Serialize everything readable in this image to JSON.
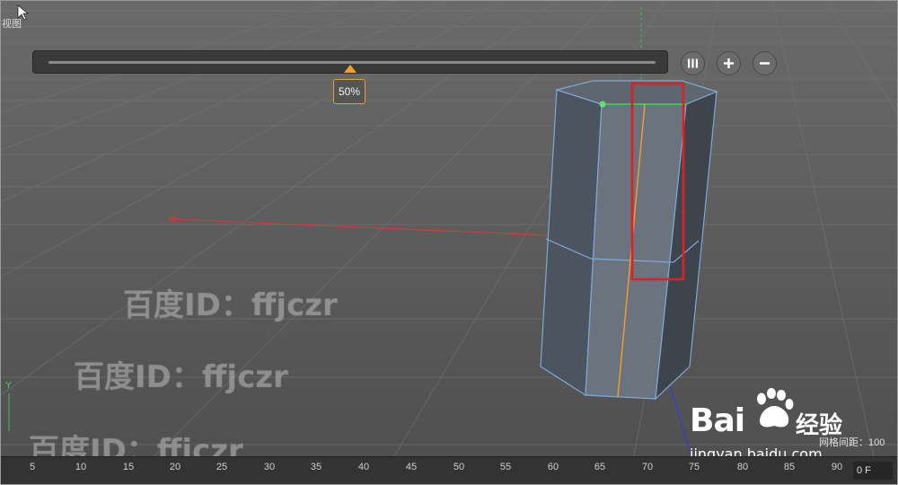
{
  "viewport": {
    "view_label": "视图",
    "slider_percent_label": "50%",
    "slider_value": 0.5,
    "grid_spacing_label": "网格间距：100"
  },
  "watermarks": [
    "百度ID：ffjczr",
    "百度ID：ffjczr",
    "百度ID：ffjczr"
  ],
  "baidu": {
    "logo_text": "Bai",
    "jingyan_text": "经验",
    "url": "jingyan.baidu.com"
  },
  "timeline": {
    "ticks": [
      "5",
      "10",
      "15",
      "20",
      "25",
      "30",
      "35",
      "40",
      "45",
      "50",
      "55",
      "60",
      "65",
      "70",
      "75",
      "80",
      "85",
      "90"
    ],
    "frame": "0 F"
  },
  "axes": {
    "y_label": "Y"
  },
  "colors": {
    "viewport_bg": "#5a5a5a",
    "grid_line": "#6e6e6e",
    "x_axis": "#d23a3a",
    "y_axis": "#3fc05a",
    "z_axis": "#3a3ad0",
    "mesh_edge": "#7fa8d8",
    "highlight_box": "#e02020",
    "selected_edge": "#f0a030",
    "timeline_bg": "#333333"
  },
  "icons": [
    "cursor-icon",
    "pause-bars-icon",
    "plus-icon",
    "minus-icon",
    "baidu-paw-icon"
  ]
}
